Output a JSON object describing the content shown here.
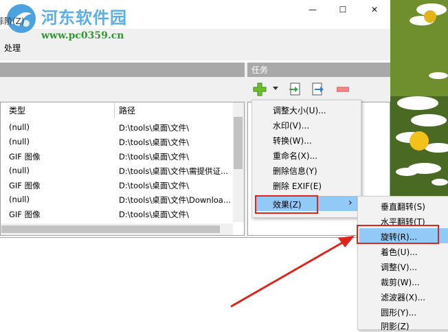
{
  "watermark": {
    "title": "河东软件园",
    "url": "www.pc0359.cn"
  },
  "menubar": {
    "fragment": "菲阶(Z)",
    "process": "处理"
  },
  "window": {
    "minimize": "—",
    "maximize": "☐",
    "close": "✕"
  },
  "task_panel": {
    "title": "任务"
  },
  "file_table": {
    "headers": [
      "类型",
      "路径"
    ],
    "rows": [
      {
        "type": "(null)",
        "path": "D:\\tools\\桌面\\文件\\"
      },
      {
        "type": "(null)",
        "path": "D:\\tools\\桌面\\文件\\"
      },
      {
        "type": "GIF 图像",
        "path": "D:\\tools\\桌面\\文件\\"
      },
      {
        "type": "(null)",
        "path": "D:\\tools\\桌面\\文件\\需提供证..."
      },
      {
        "type": "GIF 图像",
        "path": "D:\\tools\\桌面\\文件\\"
      },
      {
        "type": "(null)",
        "path": "D:\\tools\\桌面\\文件\\Downloa..."
      },
      {
        "type": "GIF 图像",
        "path": "D:\\tools\\桌面\\文件\\"
      }
    ]
  },
  "task_menu": {
    "items": [
      "调整大小(U)...",
      "水印(V)...",
      "转换(W)...",
      "重命名(X)...",
      "删除信息(Y)",
      "删除 EXIF(E)"
    ],
    "effects": "效果(Z)",
    "submenu_arrow": "›"
  },
  "effects_menu": {
    "items": [
      "垂直翻转(S)",
      "水平翻转(T)",
      "旋转(R)...",
      "着色(U)...",
      "调整(V)...",
      "裁剪(W)...",
      "滤波器(X)...",
      "圆形(Y)...",
      "阴影(Z)"
    ],
    "highlighted_index": 2
  },
  "colors": {
    "highlight": "#91c9f7",
    "annotation": "#e0241c",
    "panel_header": "#a9a9a9"
  }
}
